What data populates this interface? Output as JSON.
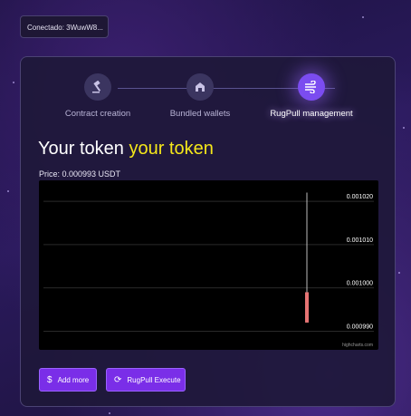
{
  "header": {
    "connected_label": "Conectado: 3WuwW8..."
  },
  "steps": [
    {
      "label": "Contract creation",
      "icon": "gavel-icon",
      "active": false
    },
    {
      "label": "Bundled wallets",
      "icon": "wallet-icon",
      "active": false
    },
    {
      "label": "RugPull management",
      "icon": "wind-icon",
      "active": true
    }
  ],
  "token": {
    "prefix": "Your token",
    "name": "your token"
  },
  "price_text": "Price: 0.000993 USDT",
  "chart_data": {
    "type": "candlestick",
    "y_ticks": [
      "0.001020",
      "0.001010",
      "0.001000",
      "0.000990"
    ],
    "ylim": [
      0.000988,
      0.001024
    ],
    "candles": [
      {
        "open": 0.000999,
        "close": 0.000992,
        "high": 0.001022,
        "low": 0.000992
      }
    ],
    "colors": {
      "down": "#e57373",
      "wick": "#bdbdbd",
      "grid": "#2a2a2a"
    },
    "watermark": "highcharts.com"
  },
  "buttons": {
    "add_more": "Add more",
    "rugpull_execute": "RugPull Execute"
  },
  "colors": {
    "accent": "#f5e71a",
    "primary": "#7a2ee8"
  }
}
